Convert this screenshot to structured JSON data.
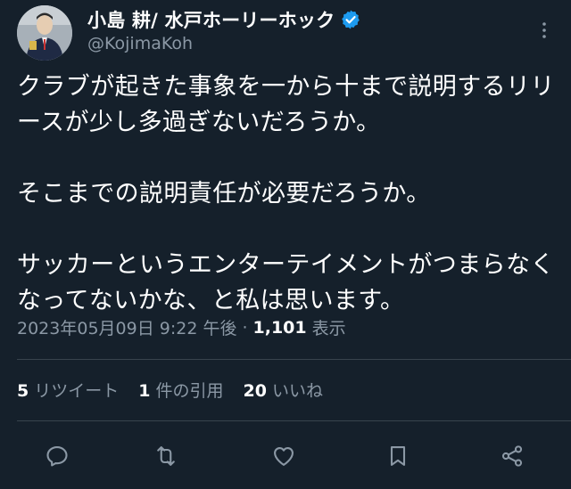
{
  "author": {
    "display_name": "小島 耕/ 水戸ホーリーホック",
    "handle": "@KojimaKoh",
    "verified": true
  },
  "tweet": {
    "text": "クラブが起きた事象を一から十まで説明するリリースが少し多過ぎないだろうか。\n\nそこまでの説明責任が必要だろうか。\n\nサッカーというエンターテイメントがつまらなくなってないかな、と私は思います。",
    "timestamp": "2023年05月09日 9:22 午後",
    "separator": "·",
    "views_count": "1,101",
    "views_label": "表示"
  },
  "stats": {
    "retweets_count": "5",
    "retweets_label": "リツイート",
    "quotes_count": "1",
    "quotes_label": "件の引用",
    "likes_count": "20",
    "likes_label": "いいね"
  },
  "icons": {
    "reply": "reply-icon",
    "retweet": "retweet-icon",
    "like": "heart-icon",
    "bookmark": "bookmark-icon",
    "share": "share-icon",
    "more": "more-icon",
    "verified": "verified-badge-icon"
  },
  "colors": {
    "background": "#15202b",
    "muted_text": "#8b98a5",
    "verified_blue": "#1d9bf0",
    "divider": "#38444d"
  }
}
